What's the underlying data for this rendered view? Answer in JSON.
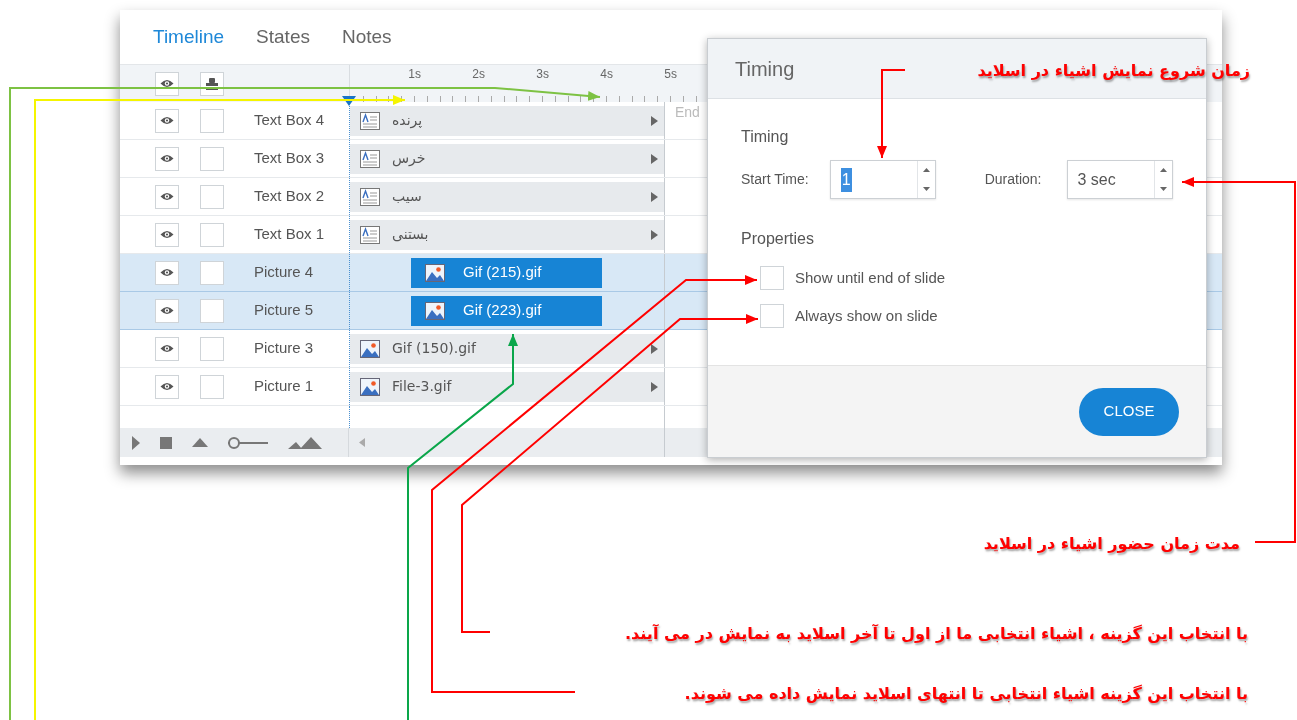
{
  "tabs": [
    {
      "label": "Timeline",
      "selected": true
    },
    {
      "label": "States",
      "selected": false
    },
    {
      "label": "Notes",
      "selected": false
    }
  ],
  "ruler": {
    "labels": [
      "1s",
      "2s",
      "3s",
      "4s",
      "5s"
    ],
    "end_label": "End"
  },
  "layers": [
    {
      "name": "Text Box 4",
      "kind": "text",
      "bar_label": "پرنده",
      "selected": false,
      "locked": false
    },
    {
      "name": "Text Box 3",
      "kind": "text",
      "bar_label": "خرس",
      "selected": false,
      "locked": false
    },
    {
      "name": "Text Box 2",
      "kind": "text",
      "bar_label": "سیب",
      "selected": false,
      "locked": false
    },
    {
      "name": "Text Box 1",
      "kind": "text",
      "bar_label": "بستنی",
      "selected": false,
      "locked": false
    },
    {
      "name": "Picture 4",
      "kind": "picture",
      "bar_label": "Gif (215).gif",
      "selected": true,
      "locked": false
    },
    {
      "name": "Picture 5",
      "kind": "picture",
      "bar_label": "Gif (223).gif",
      "selected": true,
      "locked": false
    },
    {
      "name": "Picture 3",
      "kind": "picture",
      "bar_label": "Gif (150).gif",
      "selected": false,
      "locked": false
    },
    {
      "name": "Picture 1",
      "kind": "picture",
      "bar_label": "File-3.gif",
      "selected": false,
      "locked": false
    }
  ],
  "zoom": {
    "level": 0
  },
  "dialog": {
    "title": "Timing",
    "section": "Timing",
    "start_time": {
      "label": "Start Time:",
      "value": "1",
      "highlighted": true
    },
    "duration": {
      "label": "Duration:",
      "value": "3 sec"
    },
    "properties_title": "Properties",
    "options": [
      {
        "label": "Show until end of slide",
        "checked": false
      },
      {
        "label": "Always show on slide",
        "checked": false
      }
    ],
    "close_button": "CLOSE"
  },
  "annotations": [
    "زمان شروع نمایش اشیاء در  اسلاید",
    "مدت زمان حضور اشیاء در اسلاید",
    "با انتخاب این گزینه ، اشیاء انتخابی ما از اول تا آخر اسلاید به نمایش در می آیند.",
    "با انتخاب این گزینه اشیاء انتخابی تا انتهای اسلاید نمایش داده می شوند."
  ]
}
